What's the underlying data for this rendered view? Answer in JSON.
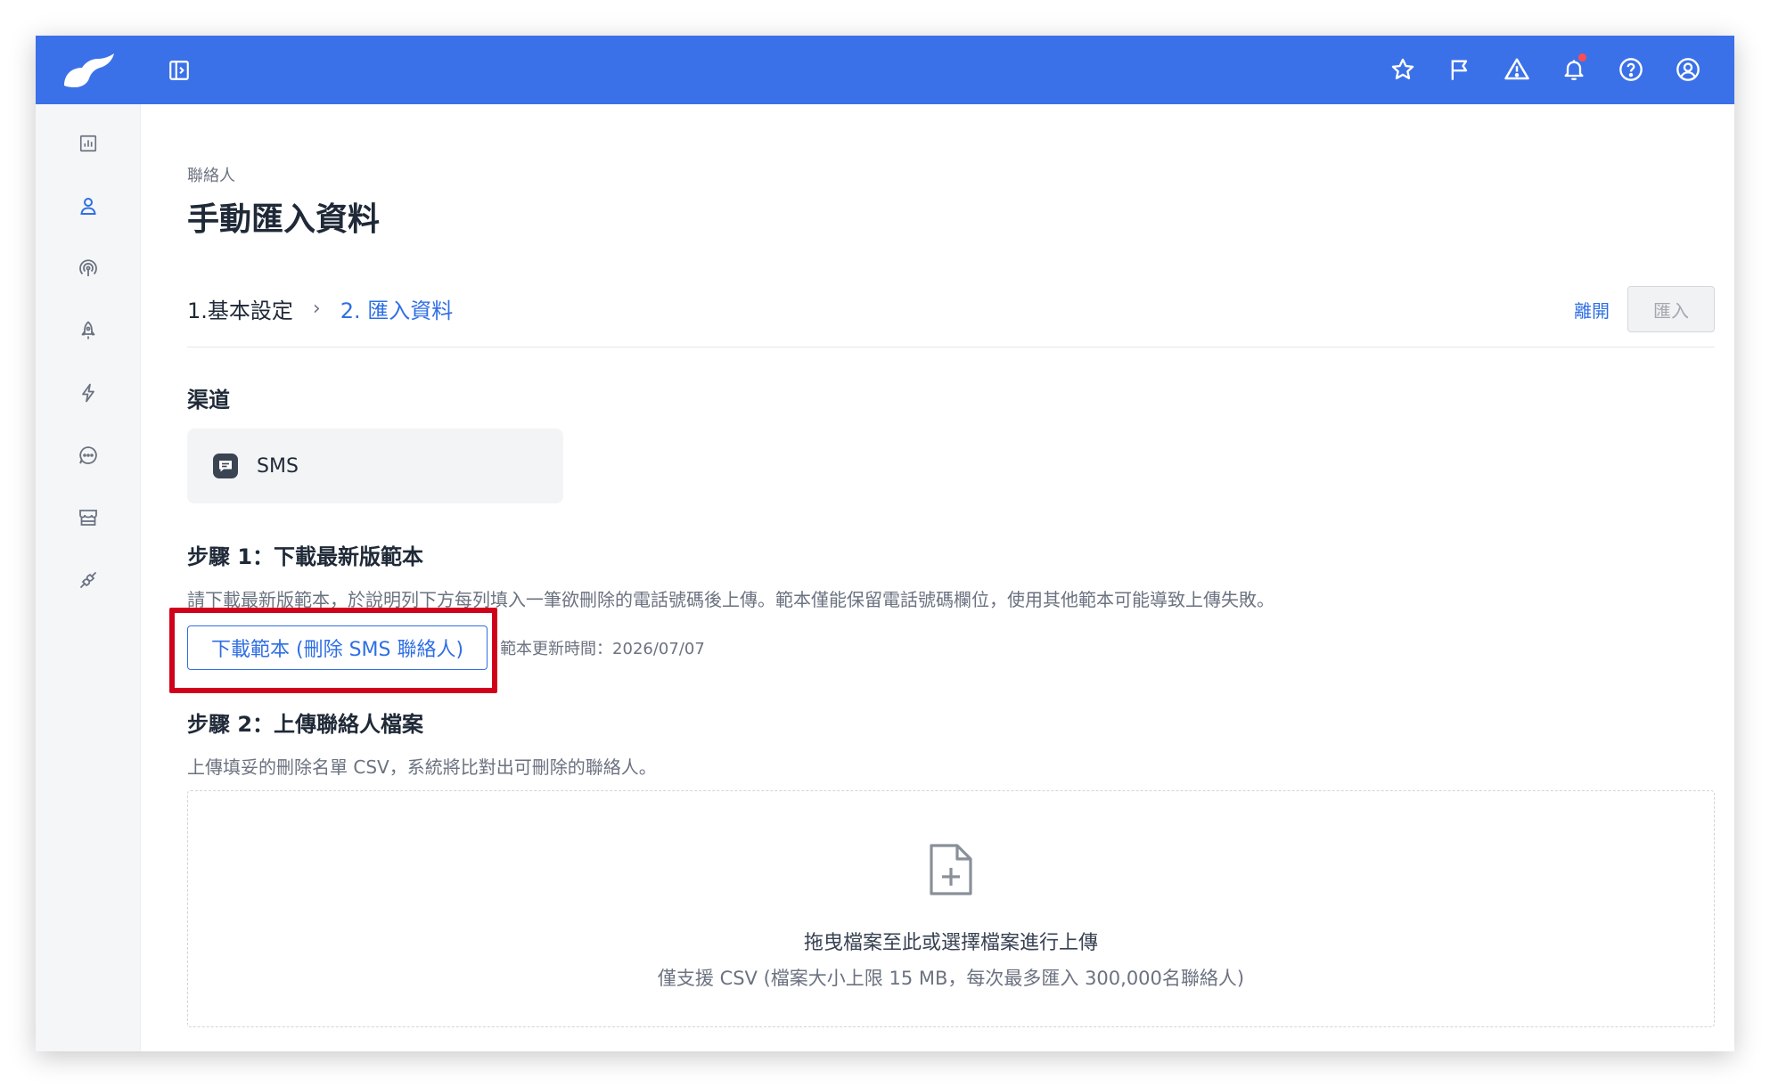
{
  "header": {
    "icons": [
      "star-icon",
      "flag-icon",
      "warning-icon",
      "bell-icon",
      "help-icon",
      "user-icon"
    ],
    "brand_color": "#3b71e8"
  },
  "sidebar": {
    "icons": [
      "dashboard-icon",
      "contacts-icon",
      "broadcast-icon",
      "rocket-icon",
      "automation-icon",
      "chat-icon",
      "store-icon",
      "integration-icon"
    ],
    "active_index": 1
  },
  "page": {
    "breadcrumb": "聯絡人",
    "title": "手動匯入資料"
  },
  "steps": {
    "step1": "1.基本設定",
    "separator": "›",
    "step2": "2. 匯入資料"
  },
  "actions": {
    "leave": "離開",
    "import": "匯入"
  },
  "channel": {
    "label": "渠道",
    "name": "SMS"
  },
  "step1": {
    "title": "步驟 1：下載最新版範本",
    "description": "請下載最新版範本，於說明列下方每列填入一筆欲刪除的電話號碼後上傳。範本僅能保留電話號碼欄位，使用其他範本可能導致上傳失敗。",
    "download_button": "下載範本 (刪除 SMS 聯絡人)",
    "updated_time": "範本更新時間：2026/07/07"
  },
  "step2": {
    "title": "步驟 2：上傳聯絡人檔案",
    "description": "上傳填妥的刪除名單 CSV，系統將比對出可刪除的聯絡人。",
    "drop_title": "拖曳檔案至此或選擇檔案進行上傳",
    "drop_hint": "僅支援 CSV (檔案大小上限 15 MB，每次最多匯入 300,000名聯絡人)"
  },
  "colors": {
    "accent": "#2f6fe4",
    "highlight": "#d0021b",
    "notification": "#ff4d4f"
  }
}
